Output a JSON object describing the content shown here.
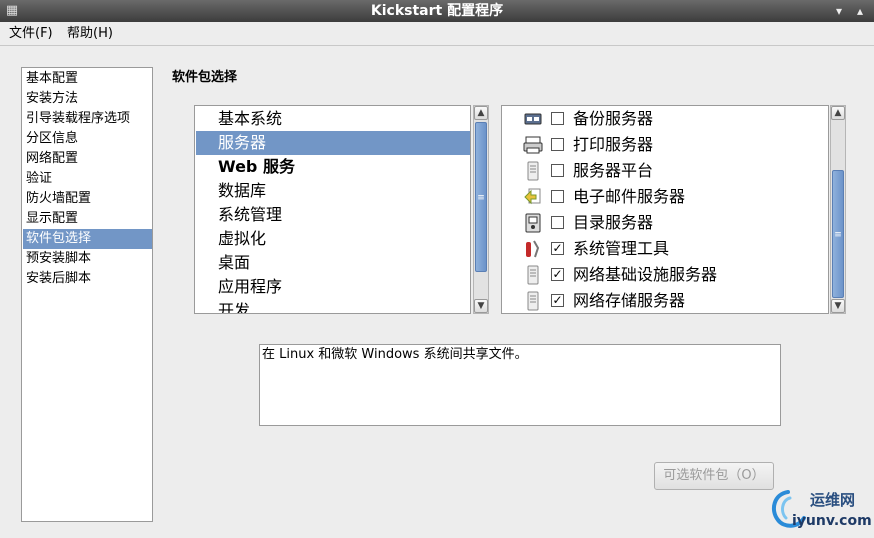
{
  "window": {
    "title": "Kickstart 配置程序",
    "minimize_glyph": "▾",
    "maximize_glyph": "▴"
  },
  "menu": {
    "file": "文件(F)",
    "help": "帮助(H)"
  },
  "nav": {
    "items": [
      "基本配置",
      "安装方法",
      "引导装载程序选项",
      "分区信息",
      "网络配置",
      "验证",
      "防火墙配置",
      "显示配置",
      "软件包选择",
      "预安装脚本",
      "安装后脚本"
    ],
    "selected_index": 8
  },
  "section_title": "软件包选择",
  "categories": {
    "items": [
      "基本系统",
      "服务器",
      "Web 服务",
      "数据库",
      "系统管理",
      "虚拟化",
      "桌面",
      "应用程序",
      "开发"
    ],
    "selected_index": 1
  },
  "packages": [
    {
      "icon": "backup-icon",
      "label": "备份服务器",
      "checked": false
    },
    {
      "icon": "printer-icon",
      "label": "打印服务器",
      "checked": false
    },
    {
      "icon": "server-icon",
      "label": "服务器平台",
      "checked": false
    },
    {
      "icon": "mail-icon",
      "label": "电子邮件服务器",
      "checked": false
    },
    {
      "icon": "directory-icon",
      "label": "目录服务器",
      "checked": false
    },
    {
      "icon": "tools-icon",
      "label": "系统管理工具",
      "checked": true
    },
    {
      "icon": "server-icon",
      "label": "网络基础设施服务器",
      "checked": true
    },
    {
      "icon": "server-icon",
      "label": "网络存储服务器",
      "checked": true
    }
  ],
  "check_glyph": "✓",
  "description": "在 Linux 和微软 Windows 系统间共享文件。",
  "optional_button": "可选软件包（O）",
  "watermark": {
    "line1": "运维网",
    "line2": "iyunv.com"
  },
  "colors": {
    "selection": "#7296c6",
    "titlebar": "#4a4a4a"
  }
}
